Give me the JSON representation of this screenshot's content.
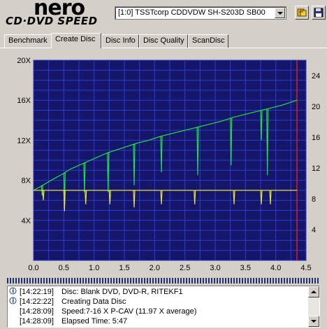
{
  "logo": {
    "brand": "nero",
    "product": "CD·DVD SPEED"
  },
  "drive": {
    "selected": "[1:0]   TSSTcorp CDDVDW SH-S203D SB00"
  },
  "toolbar": {
    "eject_icon": "eject-icon",
    "save_icon": "floppy-save-icon"
  },
  "tabs": [
    {
      "label": "Benchmark"
    },
    {
      "label": "Create Disc"
    },
    {
      "label": "Disc Info"
    },
    {
      "label": "Disc Quality"
    },
    {
      "label": "ScanDisc"
    }
  ],
  "active_tab": "Create Disc",
  "chart_data": {
    "type": "line",
    "title": "",
    "xlabel": "",
    "ylabel": "",
    "y2label": "",
    "xlim": [
      0,
      4.5
    ],
    "ylim": [
      0,
      20
    ],
    "y2lim": [
      0,
      26
    ],
    "x_ticks": [
      "0.0",
      "0.5",
      "1.0",
      "1.5",
      "2.0",
      "2.5",
      "3.0",
      "3.5",
      "4.0",
      "4.5"
    ],
    "y_ticks": [
      "4X",
      "8X",
      "12X",
      "16X",
      "20X"
    ],
    "y2_ticks": [
      "4",
      "8",
      "12",
      "16",
      "20",
      "24"
    ],
    "end_marker_x": 4.35,
    "grid": true,
    "colors": {
      "background": "#15166a",
      "grid": "#2a3bd0",
      "speed": "#20e040",
      "rpm": "#e6e23a",
      "end_marker": "#d02020"
    },
    "series": [
      {
        "color": "#20e040",
        "x": [
          0.0,
          0.15,
          0.35,
          0.5,
          0.6,
          0.75,
          0.9,
          1.05,
          1.2,
          1.35,
          1.5,
          1.7,
          1.9,
          2.1,
          2.3,
          2.5,
          2.7,
          2.9,
          3.1,
          3.3,
          3.5,
          3.7,
          3.9,
          4.1,
          4.3,
          4.35
        ],
        "y": [
          7.0,
          7.5,
          8.2,
          8.7,
          9.1,
          9.5,
          9.9,
          10.3,
          10.7,
          11.0,
          11.3,
          11.7,
          12.0,
          12.4,
          12.7,
          13.0,
          13.3,
          13.6,
          13.9,
          14.3,
          14.6,
          14.9,
          15.2,
          15.5,
          15.9,
          16.0
        ],
        "dips": [
          {
            "x": 0.13,
            "y": 6.5
          },
          {
            "x": 0.5,
            "y": 5.5
          },
          {
            "x": 0.83,
            "y": 6.8
          },
          {
            "x": 1.22,
            "y": 6.8
          },
          {
            "x": 1.65,
            "y": 7.5
          },
          {
            "x": 2.1,
            "y": 8.8
          },
          {
            "x": 2.7,
            "y": 8.5
          },
          {
            "x": 3.25,
            "y": 9.5
          },
          {
            "x": 3.75,
            "y": 12.0
          },
          {
            "x": 3.85,
            "y": 8.5
          }
        ]
      },
      {
        "color": "#e6e23a",
        "x": [
          0.0,
          4.35
        ],
        "y": [
          7.0,
          7.0
        ],
        "dips": [
          {
            "x": 0.15,
            "y": 6.0
          },
          {
            "x": 0.5,
            "y": 4.9
          },
          {
            "x": 0.85,
            "y": 5.6
          },
          {
            "x": 1.25,
            "y": 5.6
          },
          {
            "x": 1.65,
            "y": 5.3
          },
          {
            "x": 2.1,
            "y": 5.6
          },
          {
            "x": 2.65,
            "y": 5.6
          },
          {
            "x": 3.3,
            "y": 5.6
          },
          {
            "x": 3.75,
            "y": 5.6
          },
          {
            "x": 3.9,
            "y": 5.6
          }
        ]
      }
    ]
  },
  "log": [
    {
      "time": "[14:22:19]",
      "text": "Disc: Blank DVD, DVD-R, RITEKF1",
      "icon": "info-icon"
    },
    {
      "time": "[14:22:22]",
      "text": "Creating Data Disc",
      "icon": "info-icon"
    },
    {
      "time": "[14:28:09]",
      "text": "Speed:7-16 X P-CAV (11.97 X average)",
      "icon": ""
    },
    {
      "time": "[14:28:09]",
      "text": "Elapsed Time:  5:47",
      "icon": ""
    }
  ]
}
